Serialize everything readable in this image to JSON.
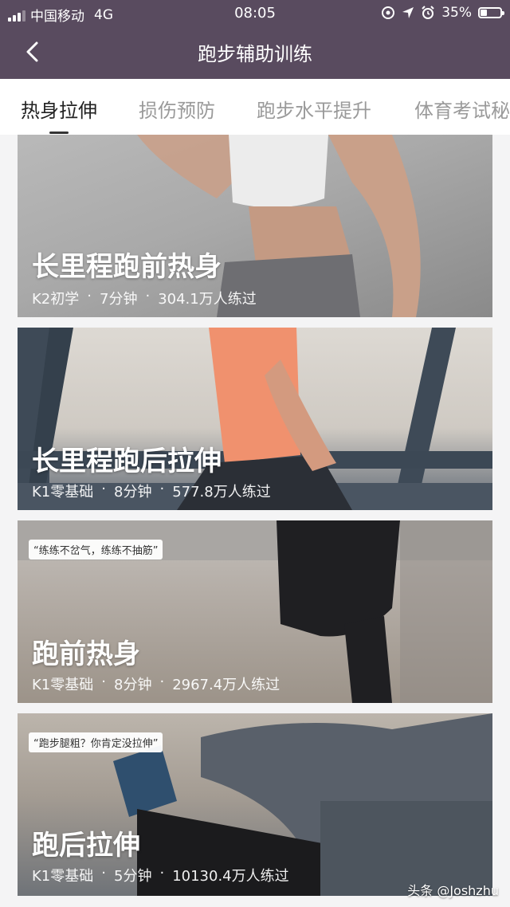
{
  "status_bar": {
    "carrier": "中国移动",
    "network": "4G",
    "time": "08:05",
    "battery": "35%",
    "battery_level": 0.35
  },
  "header": {
    "title": "跑步辅助训练"
  },
  "tabs": [
    {
      "label": "热身拉伸",
      "active": true
    },
    {
      "label": "损伤预防",
      "active": false
    },
    {
      "label": "跑步水平提升",
      "active": false
    },
    {
      "label": "体育考试秘",
      "active": false
    }
  ],
  "cards": [
    {
      "title": "长里程跑前热身",
      "level": "K2初学",
      "duration": "7分钟",
      "trained": "304.1万人练过",
      "quote": ""
    },
    {
      "title": "长里程跑后拉伸",
      "level": "K1零基础",
      "duration": "8分钟",
      "trained": "577.8万人练过",
      "quote": ""
    },
    {
      "title": "跑前热身",
      "level": "K1零基础",
      "duration": "8分钟",
      "trained": "2967.4万人练过",
      "quote": "“练练不岔气，练练不抽筋”"
    },
    {
      "title": "跑后拉伸",
      "level": "K1零基础",
      "duration": "5分钟",
      "trained": "10130.4万人练过",
      "quote": "“跑步腿粗？你肯定没拉伸”"
    }
  ],
  "meta_separator": "·",
  "watermark": "头条 @Joshzhu",
  "icons": [
    "signal-icon",
    "back-chevron-icon",
    "location-icon",
    "arrow-icon",
    "alarm-icon",
    "battery-icon"
  ]
}
